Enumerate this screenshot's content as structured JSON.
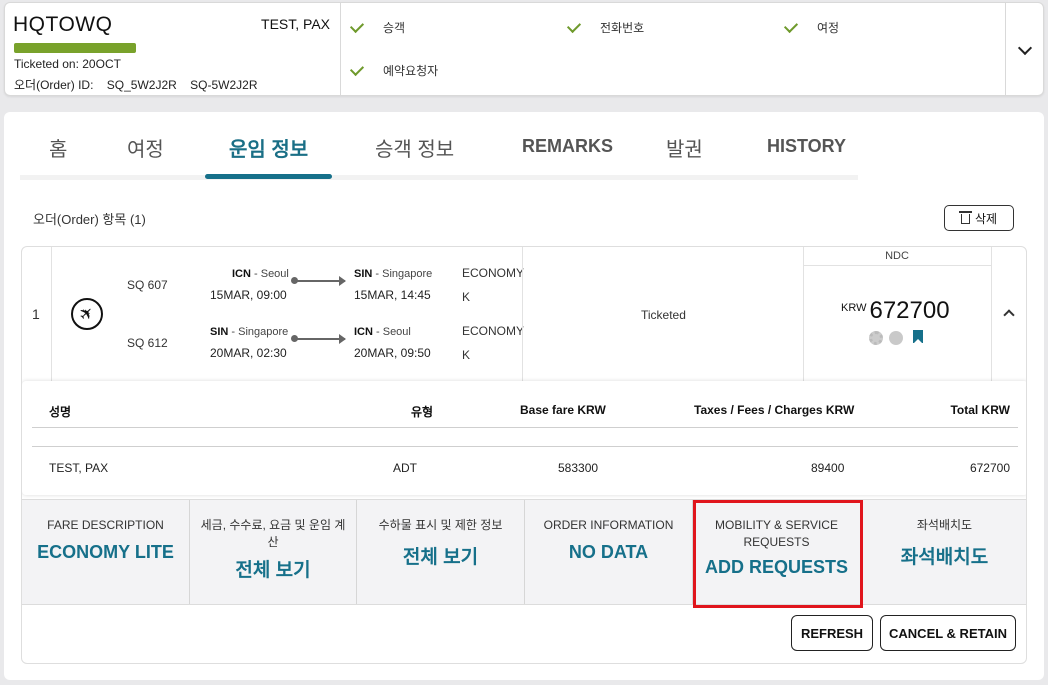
{
  "header": {
    "pnr": "HQTOWQ",
    "passenger": "TEST, PAX",
    "ticketed": "Ticketed on: 20OCT",
    "order_id_label": "오더(Order) ID:",
    "order_ids": [
      "SQ_5W2J2R",
      "SQ-5W2J2R"
    ],
    "progress_color": "#79a22b",
    "checks": [
      "승객",
      "전화번호",
      "여정",
      "예약요청자"
    ]
  },
  "tabs": [
    "홈",
    "여정",
    "운임 정보",
    "승객 정보",
    "REMARKS",
    "발권",
    "HISTORY"
  ],
  "active_tab": "운임 정보",
  "order": {
    "title": "오더(Order) 항목 (1)",
    "delete_label": "삭제",
    "index": "1",
    "segments": [
      {
        "flight": "SQ 607",
        "from_code": "ICN",
        "from_city": " - Seoul",
        "dep": "15MAR, 09:00",
        "to_code": "SIN",
        "to_city": " - Singapore",
        "arr": "15MAR, 14:45",
        "cabin": "ECONOMY",
        "class": "K"
      },
      {
        "flight": "SQ 612",
        "from_code": "SIN",
        "from_city": " - Singapore",
        "dep": "20MAR, 02:30",
        "to_code": "ICN",
        "to_city": " - Seoul",
        "arr": "20MAR, 09:50",
        "cabin": "ECONOMY",
        "class": "K"
      }
    ],
    "status": "Ticketed",
    "ndc": "NDC",
    "currency": "KRW",
    "total": "672700",
    "accent": "#16708a"
  },
  "passengers": {
    "headers": [
      "성명",
      "유형",
      "Base fare KRW",
      "Taxes / Fees / Charges KRW",
      "Total KRW"
    ],
    "rows": [
      [
        "TEST, PAX",
        "ADT",
        "583300",
        "89400",
        "672700"
      ]
    ]
  },
  "info_cells": [
    {
      "label": "FARE DESCRIPTION",
      "value": "ECONOMY LITE"
    },
    {
      "label": "세금, 수수료, 요금 및 운임 계산",
      "value": "전체 보기"
    },
    {
      "label": "수하물 표시 및 제한 정보",
      "value": "전체 보기"
    },
    {
      "label": "ORDER INFORMATION",
      "value": "NO DATA"
    },
    {
      "label": "MOBILITY & SERVICE REQUESTS",
      "value": "ADD REQUESTS"
    },
    {
      "label": "좌석배치도",
      "value": "좌석배치도"
    }
  ],
  "buttons": {
    "refresh": "REFRESH",
    "cancel_retain": "CANCEL & RETAIN"
  }
}
